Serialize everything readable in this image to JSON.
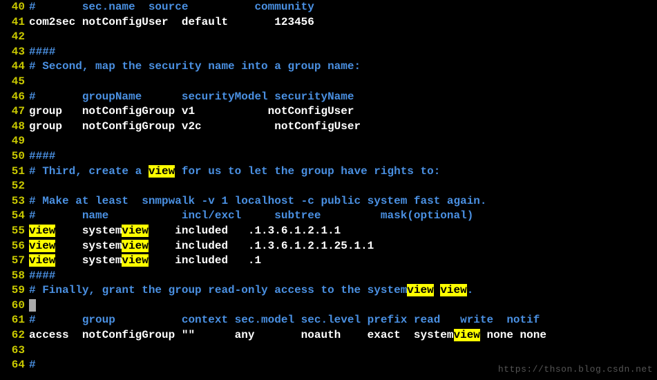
{
  "watermark": "https://thson.blog.csdn.net",
  "lines": {
    "40": {
      "type": "comment-header",
      "segments": [
        {
          "t": "#       sec.name  source          community",
          "cls": "cmt"
        }
      ]
    },
    "41": {
      "type": "code",
      "segments": [
        {
          "t": "com2sec notConfigUser  default       123456",
          "cls": "txt"
        }
      ]
    },
    "42": {
      "type": "blank",
      "segments": []
    },
    "43": {
      "type": "comment",
      "segments": [
        {
          "t": "####",
          "cls": "cmt"
        }
      ]
    },
    "44": {
      "type": "comment",
      "segments": [
        {
          "t": "# Second, map the security name into a group name:",
          "cls": "cmt"
        }
      ]
    },
    "45": {
      "type": "blank",
      "segments": []
    },
    "46": {
      "type": "comment",
      "segments": [
        {
          "t": "#       groupName      securityModel securityName",
          "cls": "cmt"
        }
      ]
    },
    "47": {
      "type": "code",
      "segments": [
        {
          "t": "group   notConfigGroup v1           notConfigUser",
          "cls": "txt"
        }
      ]
    },
    "48": {
      "type": "code",
      "segments": [
        {
          "t": "group   notConfigGroup v2c           notConfigUser",
          "cls": "txt"
        }
      ]
    },
    "49": {
      "type": "blank",
      "segments": []
    },
    "50": {
      "type": "comment",
      "segments": [
        {
          "t": "####",
          "cls": "cmt"
        }
      ]
    },
    "51": {
      "type": "comment",
      "segments": [
        {
          "t": "# Third, create a ",
          "cls": "cmt"
        },
        {
          "t": "view",
          "cls": "hl"
        },
        {
          "t": " for us to let the group have rights to:",
          "cls": "cmt"
        }
      ]
    },
    "52": {
      "type": "blank",
      "segments": []
    },
    "53": {
      "type": "comment",
      "segments": [
        {
          "t": "# Make at least  snmpwalk -v 1 localhost -c public system fast again.",
          "cls": "cmt"
        }
      ]
    },
    "54": {
      "type": "comment",
      "segments": [
        {
          "t": "#       name           incl/excl     subtree         mask(optional)",
          "cls": "cmt"
        }
      ]
    },
    "55": {
      "type": "code",
      "segments": [
        {
          "t": "view",
          "cls": "hl"
        },
        {
          "t": "    system",
          "cls": "txt"
        },
        {
          "t": "view",
          "cls": "hl"
        },
        {
          "t": "    included   .1.3.6.1.2.1.1",
          "cls": "txt"
        }
      ]
    },
    "56": {
      "type": "code",
      "segments": [
        {
          "t": "view",
          "cls": "hl"
        },
        {
          "t": "    system",
          "cls": "txt"
        },
        {
          "t": "view",
          "cls": "hl"
        },
        {
          "t": "    included   .1.3.6.1.2.1.25.1.1",
          "cls": "txt"
        }
      ]
    },
    "57": {
      "type": "code",
      "segments": [
        {
          "t": "view",
          "cls": "hl"
        },
        {
          "t": "    system",
          "cls": "txt"
        },
        {
          "t": "view",
          "cls": "hl"
        },
        {
          "t": "    included   .1",
          "cls": "txt"
        }
      ]
    },
    "58": {
      "type": "comment",
      "segments": [
        {
          "t": "####",
          "cls": "cmt"
        }
      ]
    },
    "59": {
      "type": "comment",
      "segments": [
        {
          "t": "# Finally, grant the group read-only access to the system",
          "cls": "cmt"
        },
        {
          "t": "view",
          "cls": "hl"
        },
        {
          "t": " ",
          "cls": "cmt"
        },
        {
          "t": "view",
          "cls": "hl"
        },
        {
          "t": ".",
          "cls": "cmt"
        }
      ]
    },
    "60": {
      "type": "cursor",
      "segments": [
        {
          "t": " ",
          "cls": "cursor"
        }
      ]
    },
    "61": {
      "type": "comment",
      "segments": [
        {
          "t": "#       group          context sec.model sec.level prefix read   write  notif",
          "cls": "cmt"
        }
      ]
    },
    "62": {
      "type": "code",
      "segments": [
        {
          "t": "access  notConfigGroup \"\"      any       noauth    exact  system",
          "cls": "txt"
        },
        {
          "t": "view",
          "cls": "hl"
        },
        {
          "t": " none none",
          "cls": "txt"
        }
      ]
    },
    "63": {
      "type": "blank",
      "segments": []
    },
    "64": {
      "type": "comment-partial",
      "segments": [
        {
          "t": "#",
          "cls": "cmt"
        }
      ]
    }
  },
  "line_order": [
    "40",
    "41",
    "42",
    "43",
    "44",
    "45",
    "46",
    "47",
    "48",
    "49",
    "50",
    "51",
    "52",
    "53",
    "54",
    "55",
    "56",
    "57",
    "58",
    "59",
    "60",
    "61",
    "62",
    "63",
    "64"
  ]
}
